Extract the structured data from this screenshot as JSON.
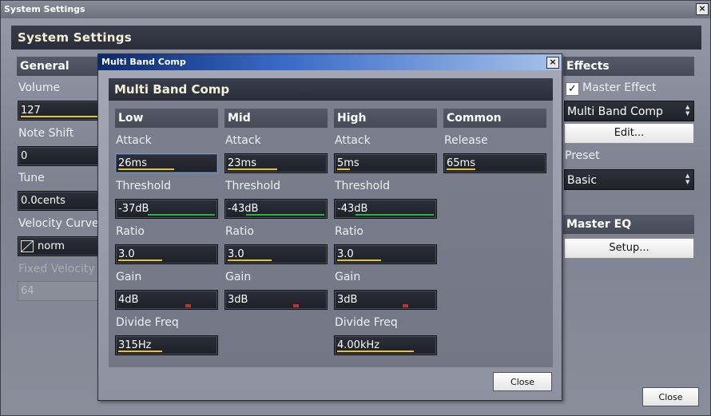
{
  "window": {
    "title": "System Settings",
    "close_glyph": "×",
    "header": "System Settings",
    "close_button": "Close"
  },
  "general": {
    "heading": "General",
    "volume_label": "Volume",
    "volume_value": "127",
    "note_shift_label": "Note Shift",
    "note_shift_value": "0",
    "tune_label": "Tune",
    "tune_value": "0.0cents",
    "velocity_curve_label": "Velocity Curve",
    "velocity_curve_value": "norm",
    "fixed_velocity_label": "Fixed Velocity",
    "fixed_velocity_value": "64"
  },
  "effects": {
    "heading": "Effects",
    "master_effect_label": "Master Effect",
    "master_effect_checked": true,
    "effect_type": "Multi Band Comp",
    "edit_button": "Edit...",
    "preset_label": "Preset",
    "preset_value": "Basic"
  },
  "master_eq": {
    "heading": "Master EQ",
    "setup_button": "Setup..."
  },
  "dialog": {
    "title": "Multi Band Comp",
    "header": "Multi Band Comp",
    "close_glyph": "×",
    "close_button": "Close",
    "columns": [
      {
        "heading": "Low",
        "attack_label": "Attack",
        "attack": "26ms",
        "threshold_label": "Threshold",
        "threshold": "-37dB",
        "ratio_label": "Ratio",
        "ratio": "3.0",
        "gain_label": "Gain",
        "gain": "4dB",
        "divide_label": "Divide Freq",
        "divide": "315Hz"
      },
      {
        "heading": "Mid",
        "attack_label": "Attack",
        "attack": "23ms",
        "threshold_label": "Threshold",
        "threshold": "-43dB",
        "ratio_label": "Ratio",
        "ratio": "3.0",
        "gain_label": "Gain",
        "gain": "3dB"
      },
      {
        "heading": "High",
        "attack_label": "Attack",
        "attack": "5ms",
        "threshold_label": "Threshold",
        "threshold": "-43dB",
        "ratio_label": "Ratio",
        "ratio": "3.0",
        "gain_label": "Gain",
        "gain": "3dB",
        "divide_label": "Divide Freq",
        "divide": "4.00kHz"
      },
      {
        "heading": "Common",
        "release_label": "Release",
        "release": "65ms"
      }
    ]
  },
  "colors": {
    "level_bar": "#e8c522",
    "threshold_bar": "#2ab43a",
    "gain_marker": "#c4302a",
    "header_bg": "#2a2d38"
  }
}
